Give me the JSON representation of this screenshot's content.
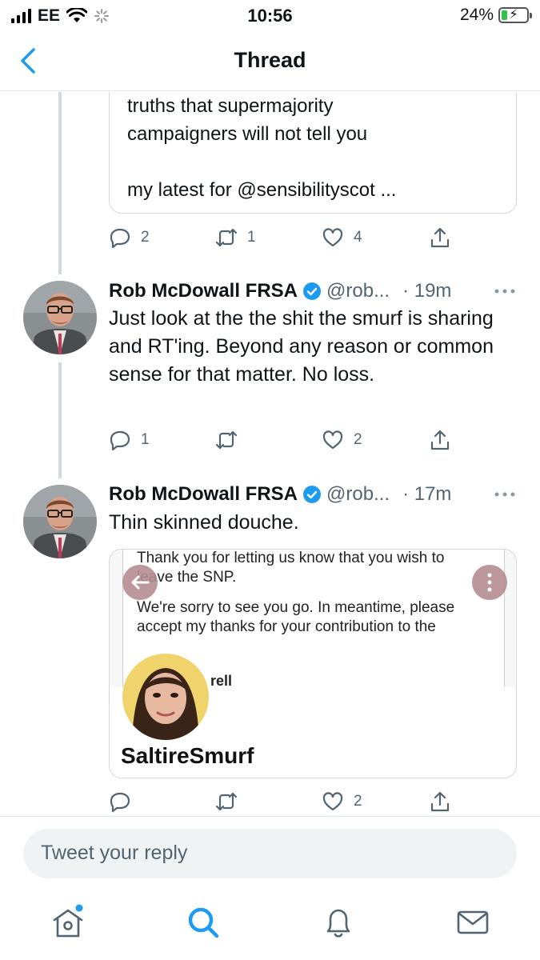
{
  "status_bar": {
    "carrier": "EE",
    "time": "10:56",
    "battery": "24%",
    "battery_level": 0.24
  },
  "nav": {
    "title": "Thread"
  },
  "tweets": [
    {
      "card_text_lines": [
        "truths that supermajority",
        "campaigners will not tell you",
        "",
        "my latest for @sensibilityscot ..."
      ],
      "actions": {
        "replies": "2",
        "retweets": "1",
        "likes": "4"
      }
    },
    {
      "name": "Rob McDowall FRSA",
      "handle": "@rob...",
      "time": "· 19m",
      "body": "Just look at the the shit the smurf is sharing and RT'ing. Beyond any reason or common sense for that matter. No loss.",
      "actions": {
        "replies": "1",
        "retweets": "",
        "likes": "2"
      }
    },
    {
      "name": "Rob McDowall FRSA",
      "handle": "@rob...",
      "time": "· 17m",
      "body": "Thin skinned douche.",
      "media": {
        "para1": "Thank you for letting us know that you wish to leave the SNP.",
        "para2": "We're sorry to see you go. In meantime, please accept my thanks for your contribution to the party.",
        "partial_name": "rell",
        "caption": "SaltireSmurf"
      },
      "actions": {
        "replies": "",
        "retweets": "",
        "likes": "2"
      }
    }
  ],
  "reply": {
    "placeholder": "Tweet your reply"
  },
  "tabs": [
    "home-icon",
    "search-icon",
    "notifications-icon",
    "messages-icon"
  ],
  "colors": {
    "accent": "#1d9bf0",
    "secondary_text": "#536471",
    "border": "#cfd9de"
  }
}
